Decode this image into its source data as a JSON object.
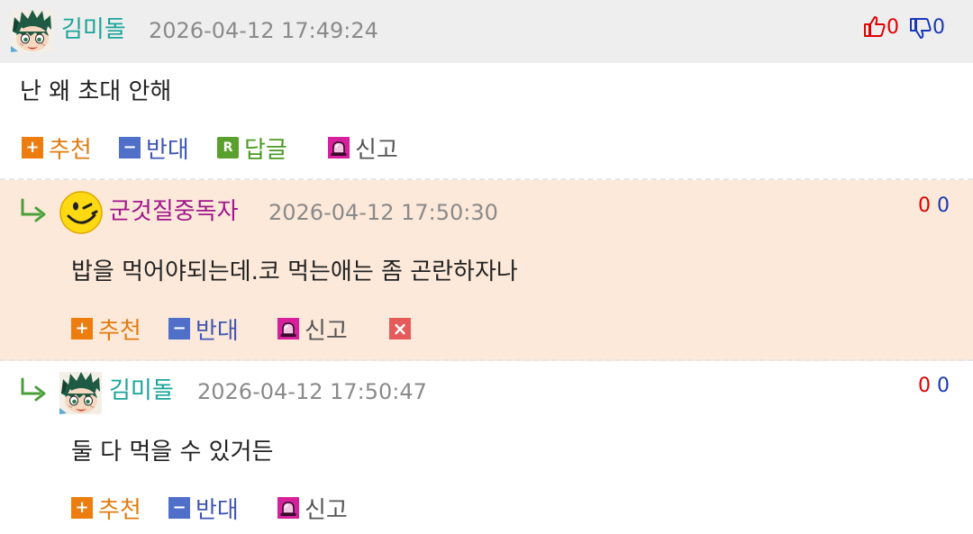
{
  "comments": [
    {
      "nick": "김미돌",
      "nick_color": "#1aa59a",
      "date": "2026-04-12 17:49:24",
      "up": "0",
      "down": "0",
      "text": "난 왜 초대 안해",
      "actions": {
        "recommend": "추천",
        "oppose": "반대",
        "reply": "답글",
        "report": "신고"
      },
      "reply_icon_letter": "R"
    },
    {
      "nick": "군것질중독자",
      "nick_color": "#a0168c",
      "date": "2026-04-12 17:50:30",
      "up": "0",
      "down": "0",
      "text": "밥을 먹어야되는데.코 먹는애는 좀 곤란하자나",
      "actions": {
        "recommend": "추천",
        "oppose": "반대",
        "report": "신고"
      }
    },
    {
      "nick": "김미돌",
      "nick_color": "#1aa59a",
      "date": "2026-04-12 17:50:47",
      "up": "0",
      "down": "0",
      "text": "둘 다 먹을 수 있거든",
      "actions": {
        "recommend": "추천",
        "oppose": "반대",
        "report": "신고"
      }
    }
  ],
  "icons": {
    "thumbs_up": "thumbs-up-icon",
    "thumbs_down": "thumbs-down-icon",
    "plus": "plus-icon",
    "minus": "minus-icon",
    "reply": "reply-icon",
    "report": "siren-icon",
    "delete": "close-icon",
    "reply_arrow": "reply-arrow-icon"
  },
  "colors": {
    "up": "#e00000",
    "down": "#1838b8",
    "reply_highlight_bg": "#fce9d9",
    "header_bg": "#eeeeee"
  }
}
